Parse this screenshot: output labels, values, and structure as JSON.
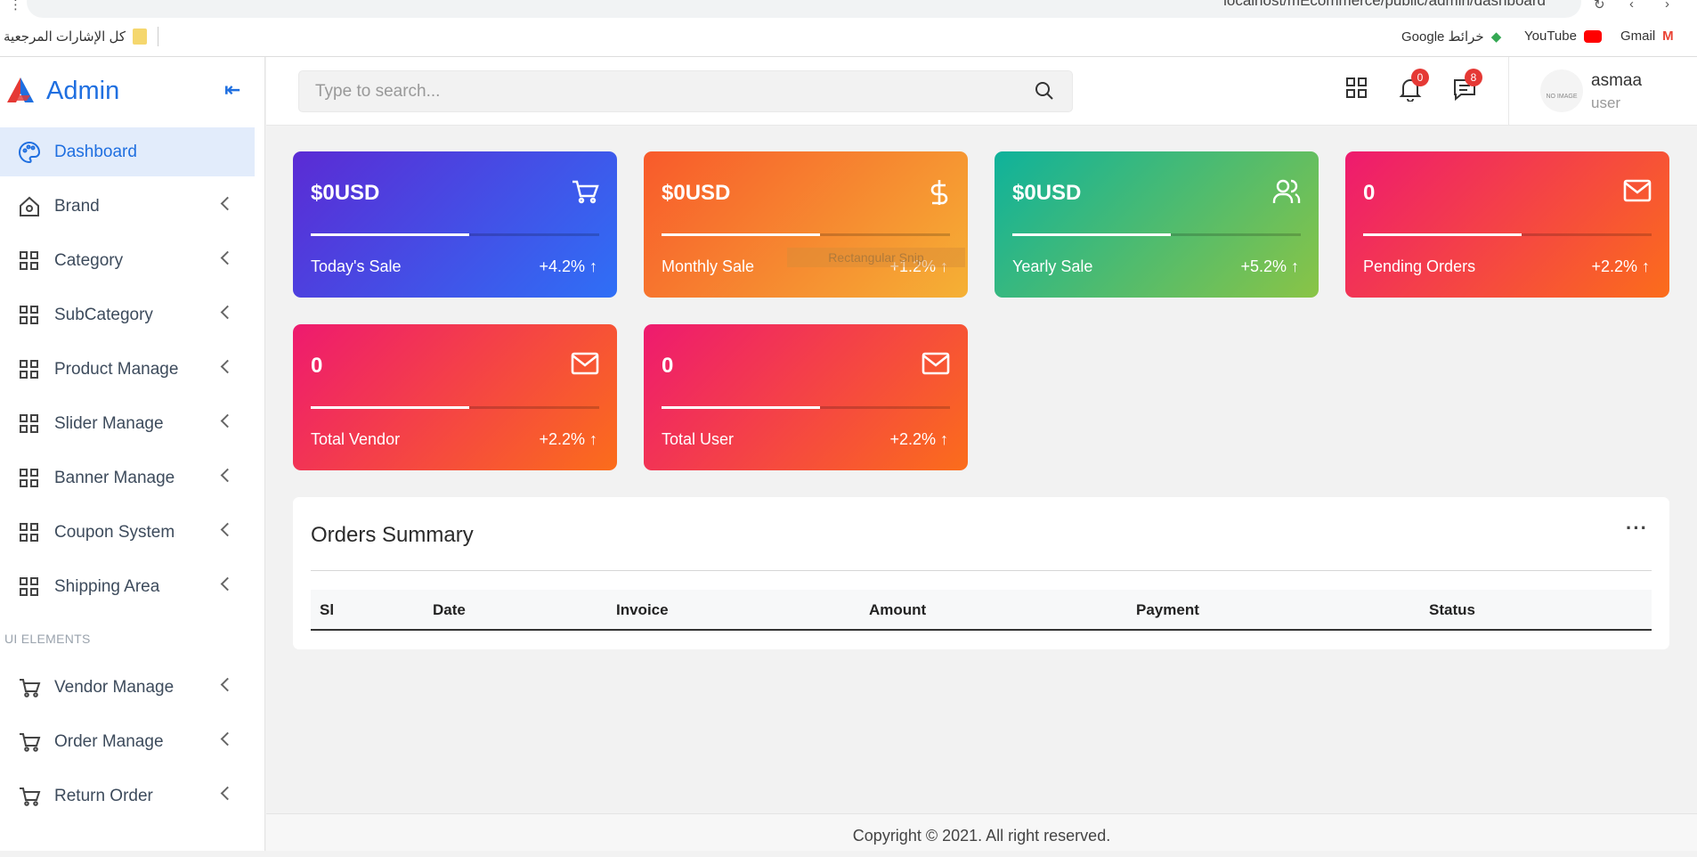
{
  "browser": {
    "url": "localhost/mEcommerce/public/admin/dashboard"
  },
  "bookmarks": {
    "all_bookmarks": "كل الإشارات المرجعية",
    "maps": "Google خرائط",
    "youtube": "YouTube",
    "gmail": "Gmail"
  },
  "sidebar": {
    "brand": "Admin",
    "items": [
      {
        "label": "Dashboard",
        "icon": "palette-icon"
      },
      {
        "label": "Brand",
        "icon": "home-icon"
      },
      {
        "label": "Category",
        "icon": "grid-icon"
      },
      {
        "label": "SubCategory",
        "icon": "grid-icon"
      },
      {
        "label": "Product Manage",
        "icon": "grid-icon"
      },
      {
        "label": "Slider Manage",
        "icon": "grid-icon"
      },
      {
        "label": "Banner Manage",
        "icon": "grid-icon"
      },
      {
        "label": "Coupon System",
        "icon": "grid-icon"
      },
      {
        "label": "Shipping Area",
        "icon": "grid-icon"
      }
    ],
    "section_label": "UI ELEMENTS",
    "items2": [
      {
        "label": "Vendor Manage",
        "icon": "cart-icon"
      },
      {
        "label": "Order Manage",
        "icon": "cart-icon"
      },
      {
        "label": "Return Order",
        "icon": "cart-icon"
      }
    ]
  },
  "topbar": {
    "search_placeholder": "Type to search...",
    "notif_count": "0",
    "msg_count": "8",
    "user_name": "asmaa",
    "user_role": "user",
    "avatar_text": "NO IMAGE"
  },
  "cards": [
    {
      "value": "$0USD",
      "label": "Today's Sale",
      "pct": "+4.2%",
      "icon": "cart-icon",
      "progress": 0.55
    },
    {
      "value": "$0USD",
      "label": "Monthly Sale",
      "pct": "+1.2%",
      "icon": "dollar-icon",
      "progress": 0.55
    },
    {
      "value": "$0USD",
      "label": "Yearly Sale",
      "pct": "+5.2%",
      "icon": "users-icon",
      "progress": 0.55
    },
    {
      "value": "0",
      "label": "Pending Orders",
      "pct": "+2.2%",
      "icon": "mail-icon",
      "progress": 0.55
    },
    {
      "value": "0",
      "label": "Total Vendor",
      "pct": "+2.2%",
      "icon": "mail-icon",
      "progress": 0.55
    },
    {
      "value": "0",
      "label": "Total User",
      "pct": "+2.2%",
      "icon": "mail-icon",
      "progress": 0.55
    }
  ],
  "tooltip": "Rectangular Snip",
  "orders": {
    "title": "Orders Summary",
    "columns": [
      "Sl",
      "Date",
      "Invoice",
      "Amount",
      "Payment",
      "Status"
    ]
  },
  "footer": "Copyright © 2021. All right reserved.",
  "colors": {
    "accent": "#1f6fe0"
  }
}
